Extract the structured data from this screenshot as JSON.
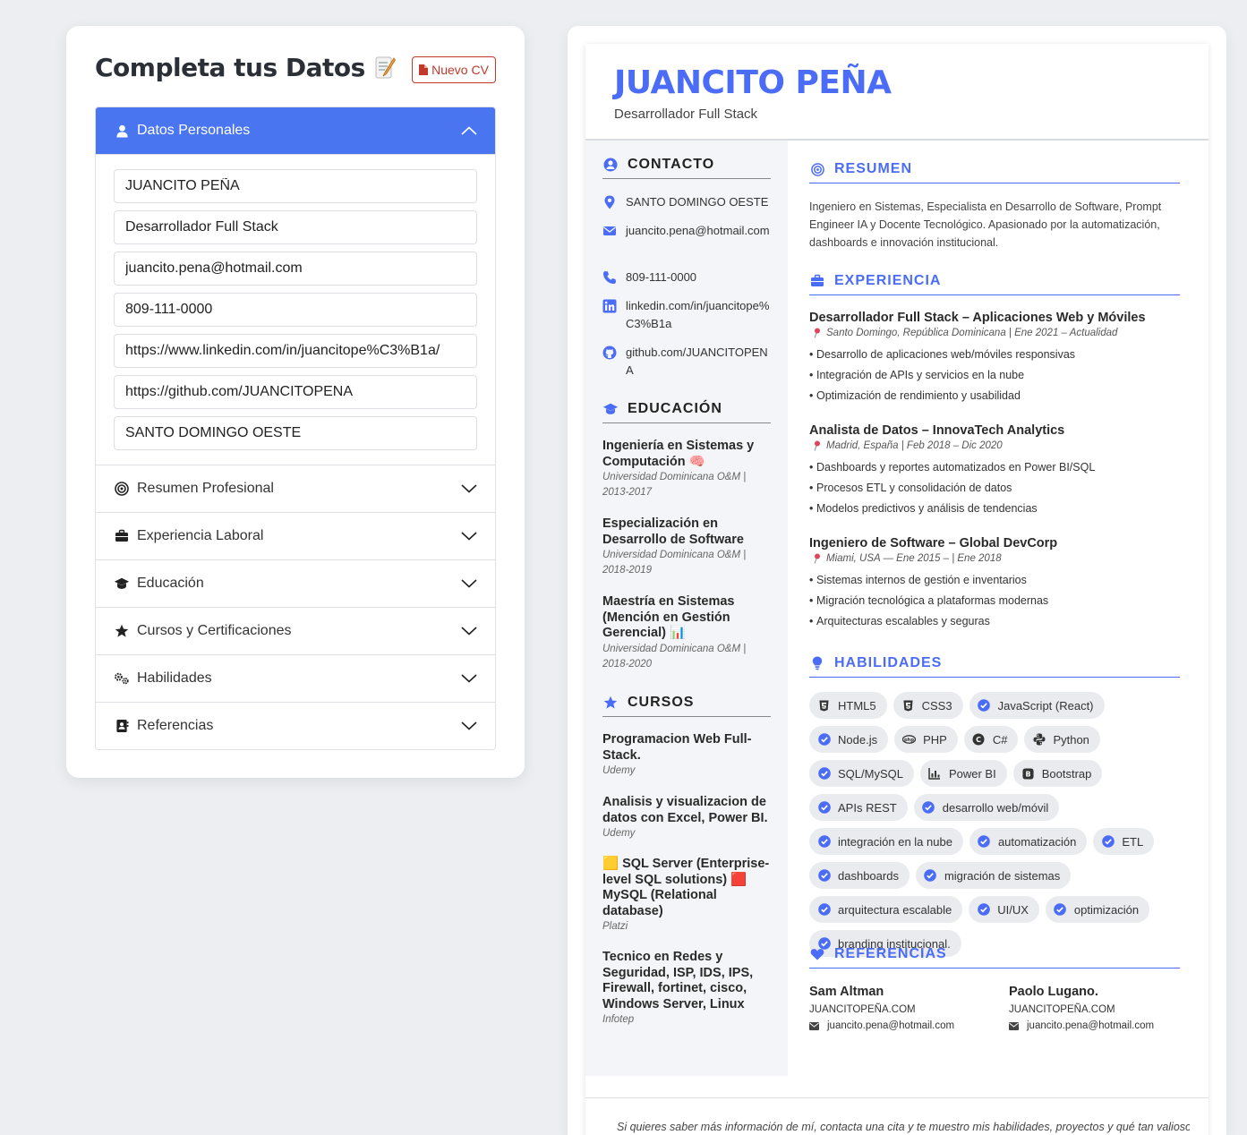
{
  "form": {
    "title": "Completa tus Datos",
    "new_cv_label": "Nuevo CV",
    "personal_section": {
      "label": "Datos Personales",
      "fields": [
        {
          "value": "JUANCITO PEÑA"
        },
        {
          "value": "Desarrollador Full Stack"
        },
        {
          "value": "juancito.pena@hotmail.com"
        },
        {
          "value": "809-111-0000"
        },
        {
          "value": "https://www.linkedin.com/in/juancitope%C3%B1a/"
        },
        {
          "value": "https://github.com/JUANCITOPENA"
        },
        {
          "value": "SANTO DOMINGO OESTE"
        }
      ]
    },
    "sections": [
      {
        "label": "Resumen Profesional",
        "icon": "bullseye-icon"
      },
      {
        "label": "Experiencia Laboral",
        "icon": "briefcase-icon"
      },
      {
        "label": "Educación",
        "icon": "graduation-cap-icon"
      },
      {
        "label": "Cursos y Certificaciones",
        "icon": "star-icon"
      },
      {
        "label": "Habilidades",
        "icon": "gears-icon"
      },
      {
        "label": "Referencias",
        "icon": "address-book-icon"
      }
    ]
  },
  "cv": {
    "name": "JUANCITO PEÑA",
    "role": "Desarrollador Full Stack",
    "accent_color": "#4a6cf7",
    "contact": {
      "heading": "CONTACTO",
      "location": "SANTO DOMINGO OESTE",
      "email": "juancito.pena@hotmail.com",
      "phone": "809-111-0000",
      "linkedin": "linkedin.com/in/juancitope%C3%B1a",
      "github": "github.com/JUANCITOPENA"
    },
    "education": {
      "heading": "EDUCACIÓN",
      "items": [
        {
          "title": "Ingeniería en Sistemas y Computación 🧠",
          "sub": "Universidad Dominicana O&M | 2013-2017"
        },
        {
          "title": "Especialización en Desarrollo de Software",
          "sub": "Universidad Dominicana O&M | 2018-2019"
        },
        {
          "title": "Maestría en Sistemas (Mención en Gestión Gerencial) 📊",
          "sub": "Universidad Dominicana O&M | 2018-2020"
        }
      ]
    },
    "courses": {
      "heading": "CURSOS",
      "items": [
        {
          "title": "Programacion Web Full-Stack.",
          "sub": "Udemy"
        },
        {
          "title": "Analisis y visualizacion de datos con Excel, Power BI.",
          "sub": "Udemy"
        },
        {
          "title": "🟨 SQL Server (Enterprise-level SQL solutions) 🟥 MySQL (Relational database)",
          "sub": "Platzi"
        },
        {
          "title": "Tecnico en Redes y Seguridad, ISP, IDS, IPS, Firewall, fortinet, cisco, Windows Server, Linux",
          "sub": "Infotep"
        }
      ]
    },
    "summary": {
      "heading": "RESUMEN",
      "text": "Ingeniero en Sistemas, Especialista en Desarrollo de Software, Prompt Engineer IA y Docente Tecnológico. Apasionado por la automatización, dashboards e innovación institucional."
    },
    "experience": {
      "heading": "EXPERIENCIA",
      "items": [
        {
          "title": "Desarrollador Full Stack – Aplicaciones Web y Móviles",
          "meta": "Santo Domingo, República Dominicana | Ene 2021 – Actualidad",
          "bullets": [
            "Desarrollo de aplicaciones web/móviles responsivas",
            "Integración de APIs y servicios en la nube",
            "Optimización de rendimiento y usabilidad"
          ]
        },
        {
          "title": "Analista de Datos – InnovaTech Analytics",
          "meta": "Madrid, España | Feb 2018 – Dic 2020",
          "bullets": [
            "Dashboards y reportes automatizados en Power BI/SQL",
            "Procesos ETL y consolidación de datos",
            "Modelos predictivos y análisis de tendencias"
          ]
        },
        {
          "title": "Ingeniero de Software – Global DevCorp",
          "meta": "Miami, USA — Ene 2015 – | Ene 2018",
          "bullets": [
            "Sistemas internos de gestión e inventarios",
            "Migración tecnológica a plataformas modernas",
            "Arquitecturas escalables y seguras"
          ]
        }
      ]
    },
    "skills": {
      "heading": "HABILIDADES",
      "items": [
        {
          "label": "HTML5",
          "icon": "html5-icon"
        },
        {
          "label": "CSS3",
          "icon": "css3-icon"
        },
        {
          "label": "JavaScript (React)",
          "icon": "check-circle-icon"
        },
        {
          "label": "Node.js",
          "icon": "check-circle-icon"
        },
        {
          "label": "PHP",
          "icon": "php-icon"
        },
        {
          "label": "C#",
          "icon": "csharp-icon"
        },
        {
          "label": "Python",
          "icon": "python-icon"
        },
        {
          "label": "SQL/MySQL",
          "icon": "check-circle-icon"
        },
        {
          "label": "Power BI",
          "icon": "chart-icon"
        },
        {
          "label": "Bootstrap",
          "icon": "bootstrap-icon"
        },
        {
          "label": "APIs REST",
          "icon": "check-circle-icon"
        },
        {
          "label": "desarrollo web/móvil",
          "icon": "check-circle-icon"
        },
        {
          "label": "integración en la nube",
          "icon": "check-circle-icon"
        },
        {
          "label": "automatización",
          "icon": "check-circle-icon"
        },
        {
          "label": "ETL",
          "icon": "check-circle-icon"
        },
        {
          "label": "dashboards",
          "icon": "check-circle-icon"
        },
        {
          "label": "migración de sistemas",
          "icon": "check-circle-icon"
        },
        {
          "label": "arquitectura escalable",
          "icon": "check-circle-icon"
        },
        {
          "label": "UI/UX",
          "icon": "check-circle-icon"
        },
        {
          "label": "optimización",
          "icon": "check-circle-icon"
        },
        {
          "label": "branding institucional.",
          "icon": "check-circle-icon"
        }
      ]
    },
    "references": {
      "heading": "REFERENCIAS",
      "items": [
        {
          "name": "Sam Altman",
          "company": "JUANCITOPEÑA.COM",
          "email": "juancito.pena@hotmail.com"
        },
        {
          "name": "Paolo Lugano.",
          "company": "JUANCITOPEÑA.COM",
          "email": "juancito.pena@hotmail.com"
        }
      ]
    },
    "footer": "Si quieres saber más información de mí, contacta una cita y te muestro mis habilidades, proyectos y qué tan valioso"
  }
}
